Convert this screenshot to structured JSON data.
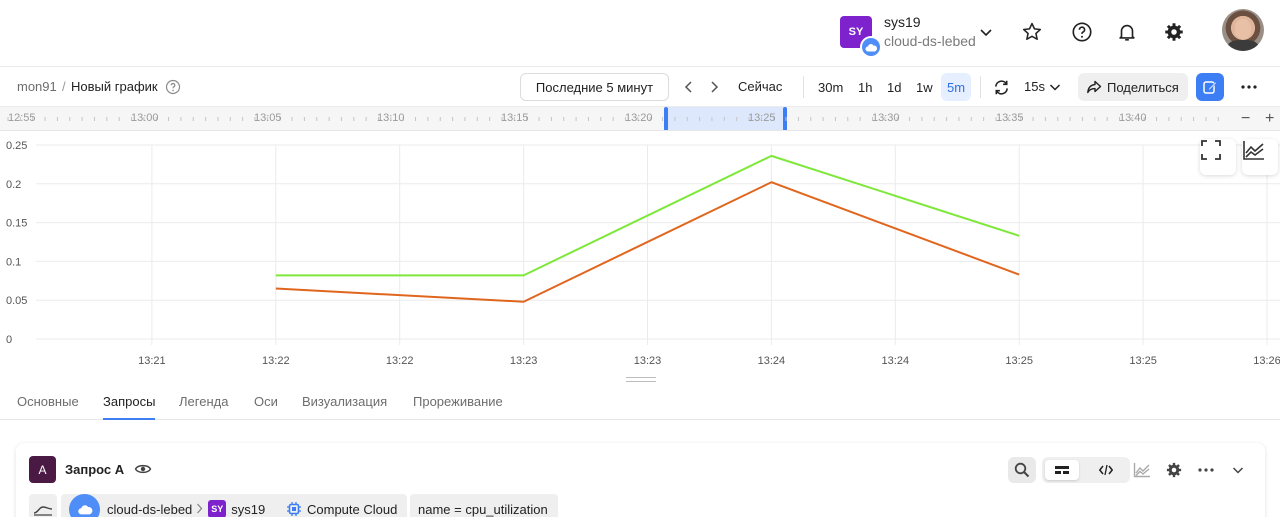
{
  "header": {
    "org_badge": "SY",
    "org_name": "sys19",
    "cloud_name": "cloud-ds-lebed",
    "icons": [
      "chevron-down-icon",
      "star-icon",
      "help-icon",
      "bell-icon",
      "gear-icon"
    ],
    "avatar": "user-avatar"
  },
  "toolbar": {
    "breadcrumb_root": "mon91",
    "breadcrumb_sep": "/",
    "breadcrumb_current": "Новый график",
    "range_label": "Последние 5 минут",
    "now_label": "Сейчас",
    "scales": [
      "30m",
      "1h",
      "1d",
      "1w",
      "5m"
    ],
    "active_scale": "5m",
    "refresh_interval": "15s",
    "share_label": "Поделиться"
  },
  "timeline": {
    "labels": [
      "12:55",
      "13:00",
      "13:05",
      "13:10",
      "13:15",
      "13:20",
      "13:25",
      "13:30",
      "13:35",
      "13:40"
    ],
    "zoom_out": "−",
    "zoom_in": "+"
  },
  "tabs": {
    "items": [
      "Основные",
      "Запросы",
      "Легенда",
      "Оси",
      "Визуализация",
      "Прореживание"
    ],
    "active": "Запросы"
  },
  "query": {
    "letter": "A",
    "title": "Запрос A",
    "cloud_chip": "cloud-ds-lebed",
    "folder_badge": "SY",
    "folder_chip": "sys19",
    "service_chip": "Compute Cloud",
    "selector_chip": "name = cpu_utilization"
  },
  "colors": {
    "accent": "#3d7ef5",
    "org_badge": "#7e22ce",
    "series_green": "#7ee83a",
    "series_orange": "#e0661e",
    "query_letter_bg": "#4a1a45"
  },
  "chart_data": {
    "type": "line",
    "x_ticks": [
      "13:21",
      "13:22",
      "13:22",
      "13:23",
      "13:23",
      "13:24",
      "13:24",
      "13:25",
      "13:25",
      "13:26"
    ],
    "y_ticks": [
      "0.25",
      "0.2",
      "0.15",
      "0.1",
      "0.05",
      "0"
    ],
    "ylim": [
      0,
      0.25
    ],
    "grid": true,
    "series": [
      {
        "color": "#7ee83a",
        "points": [
          [
            1,
            0.082
          ],
          [
            3,
            0.082
          ],
          [
            5,
            0.236
          ],
          [
            7,
            0.133
          ]
        ]
      },
      {
        "color": "#e0661e",
        "points": [
          [
            1,
            0.065
          ],
          [
            3,
            0.048
          ],
          [
            5,
            0.202
          ],
          [
            7,
            0.083
          ]
        ]
      }
    ]
  }
}
